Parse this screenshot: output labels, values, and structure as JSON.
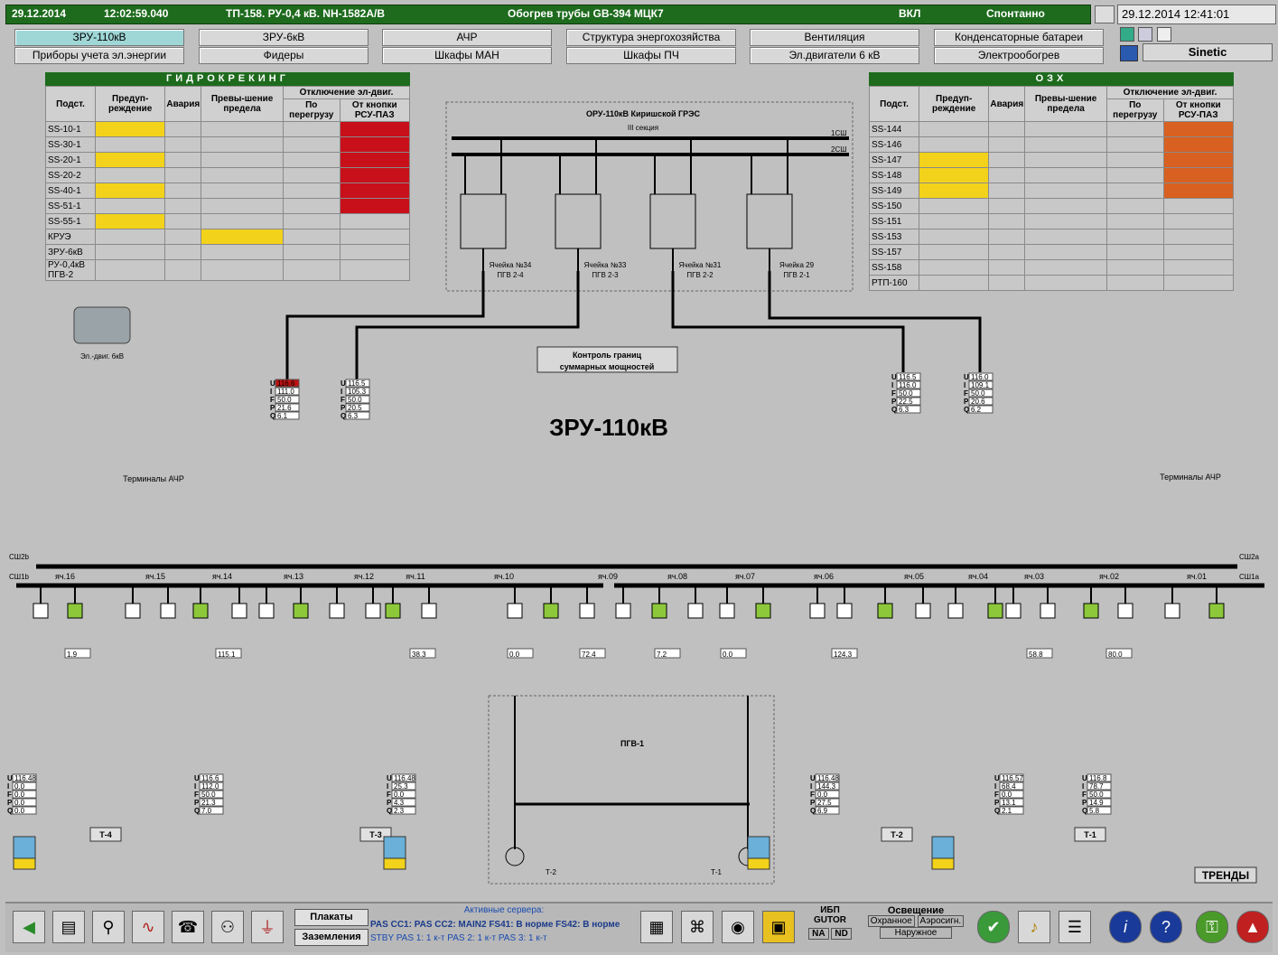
{
  "status": {
    "date": "29.12.2014",
    "time": "12:02:59.040",
    "object": "ТП-158. РУ-0,4 кВ. NH-1582A/B",
    "event": "Обогрев трубы GB-394 МЦК7",
    "state": "ВКЛ",
    "mode": "Спонтанно",
    "clock": "29.12.2014 12:41:01",
    "brand": "Sinetic"
  },
  "nav": {
    "row1": [
      "ЗРУ-110кВ",
      "ЗРУ-6кВ",
      "АЧР",
      "Структура энергохозяйства",
      "Вентиляция",
      "Конденсаторные батареи"
    ],
    "row2": [
      "Приборы учета эл.энергии",
      "Фидеры",
      "Шкафы МАН",
      "Шкафы ПЧ",
      "Эл.двигатели 6 кВ",
      "Электрообогрев"
    ]
  },
  "left_table": {
    "title": "ГИДРОКРЕКИНГ",
    "cols": [
      "Подст.",
      "Предуп-реждение",
      "Авария",
      "Превы-шение предела",
      "Отключение эл-двиг.",
      "По перегрузу",
      "От кнопки РСУ-ПАЗ"
    ],
    "rows": [
      "SS-10-1",
      "SS-30-1",
      "SS-20-1",
      "SS-20-2",
      "SS-40-1",
      "SS-51-1",
      "SS-55-1",
      "КРУЭ",
      "ЗРУ-6кВ",
      "РУ-0,4кВ ПГВ-2"
    ]
  },
  "right_table": {
    "title": "ОЗХ",
    "cols": [
      "Подст.",
      "Предуп-реждение",
      "Авария",
      "Превы-шение предела",
      "Отключение эл-двиг.",
      "По перегрузу",
      "От кнопки РСУ-ПАЗ"
    ],
    "rows": [
      "SS-144",
      "SS-146",
      "SS-147",
      "SS-148",
      "SS-149",
      "SS-150",
      "SS-151",
      "SS-153",
      "SS-157",
      "SS-158",
      "РТП-160"
    ]
  },
  "scheme": {
    "title": "ЗРУ-110кВ",
    "oru_title": "ОРУ-110кВ Киришской ГРЭС",
    "oru_section": "III секция",
    "bus1": "1СШ",
    "bus2": "2СШ",
    "cells": [
      "Ячейка №34 ПГВ 2-4",
      "Ячейка №33 ПГВ 2-3",
      "Ячейка №31 ПГВ 2-2",
      "Ячейка 29 ПГВ 2-1"
    ],
    "control_btn": "Контроль границ суммарных мощностей",
    "motor_label": "Эл.-двиг. 6кВ",
    "ach_left": "Терминалы АЧР",
    "ach_right": "Терминалы АЧР",
    "pgv": "ПГВ-1",
    "trends": "ТРЕНДЫ",
    "bays": [
      "яч.16",
      "яч.15",
      "яч.14",
      "яч.13",
      "яч.12",
      "яч.11",
      "яч.10",
      "яч.09",
      "яч.08",
      "яч.07",
      "яч.06",
      "яч.05",
      "яч.04",
      "яч.03",
      "яч.02",
      "яч.01"
    ],
    "transformers": [
      "Т-4",
      "Т-3",
      "Т-2",
      "Т-1"
    ],
    "meas_13": {
      "U": "116.6",
      "I": "111.0",
      "F": "50.0",
      "P": "21.6",
      "Q": "6.1"
    },
    "meas_12": {
      "U": "116.5",
      "I": "105.3",
      "F": "50.0",
      "P": "20.5",
      "Q": "6.3"
    },
    "meas_05": {
      "U": "116.5",
      "I": "116.0",
      "F": "50.0",
      "P": "22.5",
      "Q": "6.3"
    },
    "meas_04": {
      "U": "116.0",
      "I": "109.1",
      "F": "50.0",
      "P": "20.6",
      "Q": "6.2"
    },
    "currents": [
      "1.9",
      "115.1",
      "38.3",
      "0.0",
      "72.4",
      "7.2",
      "0.0",
      "124.3",
      "58.8",
      "80.0"
    ],
    "t4": {
      "U": "116.48",
      "I": "0.0",
      "F": "0.0",
      "P": "0.0",
      "Q": "0.0"
    },
    "t14": {
      "U": "116.6",
      "I": "112.0",
      "F": "50.0",
      "P": "21.3",
      "Q": "7.0"
    },
    "t3": {
      "U": "116.48",
      "I": "25.3",
      "F": "0.0",
      "P": "4.3",
      "Q": "2.3"
    },
    "t2": {
      "U": "116.48",
      "I": "144.3",
      "F": "0.0",
      "P": "27.5",
      "Q": "6.9"
    },
    "t03": {
      "U": "116.57",
      "I": "68.4",
      "F": "0.0",
      "P": "13.1",
      "Q": "2.1"
    },
    "t1": {
      "U": "116.8",
      "I": "78.7",
      "F": "50.0",
      "P": "14.9",
      "Q": "5.8"
    }
  },
  "toolbar": {
    "plakaty": "Плакаты",
    "zazemlenia": "Заземления",
    "servers_title": "Активные сервера:",
    "servers": "PAS CC1:  PAS CC2: MAIN2 FS41: В норме  FS42: В норме",
    "servers2": "STBY   PAS 1: 1 к-т   PAS 2: 1 к-т   PAS 3: 1 к-т",
    "ibp": "ИБП GUTOR",
    "na": "NA",
    "nd": "ND",
    "light": "Освещение",
    "light1": "Охранное",
    "light2": "Аэросигн.",
    "light3": "Наружное"
  }
}
